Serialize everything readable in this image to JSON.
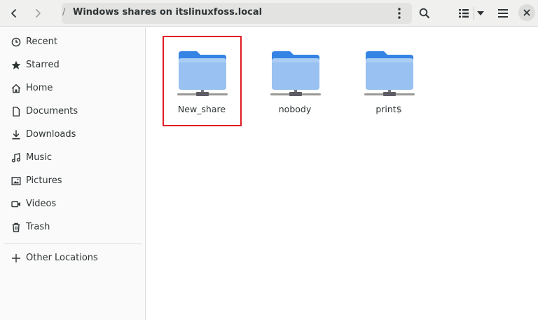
{
  "header": {
    "back_icon": "chevron-left-icon",
    "forward_icon": "chevron-right-icon",
    "path_separator": "/",
    "location_title": "Windows shares on itslinuxfoss.local",
    "path_menu_icon": "kebab-menu-icon",
    "search_icon": "search-icon",
    "view_icon": "list-view-icon",
    "view_dropdown_icon": "triangle-down-icon",
    "menu_icon": "hamburger-menu-icon",
    "close_icon": "close-icon"
  },
  "sidebar": {
    "items": [
      {
        "label": "Recent",
        "icon": "clock-icon"
      },
      {
        "label": "Starred",
        "icon": "star-icon"
      },
      {
        "label": "Home",
        "icon": "home-icon"
      },
      {
        "label": "Documents",
        "icon": "document-icon"
      },
      {
        "label": "Downloads",
        "icon": "download-icon"
      },
      {
        "label": "Music",
        "icon": "music-icon"
      },
      {
        "label": "Pictures",
        "icon": "picture-icon"
      },
      {
        "label": "Videos",
        "icon": "video-icon"
      },
      {
        "label": "Trash",
        "icon": "trash-icon"
      }
    ],
    "other_locations": {
      "label": "Other Locations",
      "icon": "plus-icon"
    }
  },
  "main": {
    "shares": [
      {
        "name": "New_share",
        "icon": "network-folder-icon",
        "highlighted": true
      },
      {
        "name": "nobody",
        "icon": "network-folder-icon",
        "highlighted": false
      },
      {
        "name": "print$",
        "icon": "network-folder-icon",
        "highlighted": false
      }
    ]
  },
  "colors": {
    "folder_back": "#3584e4",
    "folder_front": "#99c1f1",
    "highlight_border": "#e01b24",
    "header_bg": "#f0f0ef",
    "sidebar_bg": "#fafafa"
  }
}
